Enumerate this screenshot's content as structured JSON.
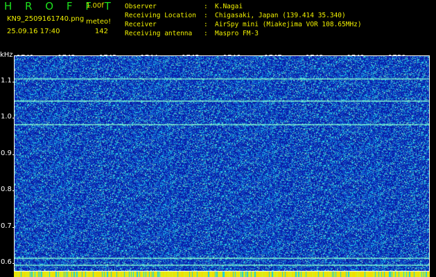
{
  "header": {
    "app_title": "H R O F F T",
    "version": "1.00f",
    "filename": "KN9_2509161740.png",
    "meteo_label": "meteo!",
    "datetime": "25.09.16 17:40",
    "count": "142"
  },
  "info": [
    {
      "key": "Observer",
      "value": "K.Nagai"
    },
    {
      "key": "Receiving Location",
      "value": "Chigasaki, Japan (139.414 35.340)"
    },
    {
      "key": "Receiver",
      "value": "AirSpy mini (Miakejima VOR 108.65MHz)"
    },
    {
      "key": "Receiving antenna",
      "value": "Maspro FM-3"
    }
  ],
  "info_separator": ":",
  "plot": {
    "y_unit": "kHz",
    "y_ticks": [
      {
        "value": 1.1,
        "label": "1.1"
      },
      {
        "value": 1.0,
        "label": "1.0"
      },
      {
        "value": 0.9,
        "label": "0.9"
      },
      {
        "value": 0.8,
        "label": "0.8"
      },
      {
        "value": 0.7,
        "label": "0.7"
      },
      {
        "value": 0.6,
        "label": "0.6"
      }
    ],
    "y_range": [
      0.578,
      1.172
    ],
    "x_ticks": [
      "1741",
      "1742",
      "1743",
      "1744",
      "1745",
      "1746",
      "1747",
      "1748",
      "1749",
      "1750"
    ],
    "x_range_minutes": [
      1740.55,
      1750.62
    ],
    "carrier_lines_khz": [
      1.112,
      1.05,
      0.985,
      0.618,
      0.598
    ],
    "colors": {
      "background": "#000000",
      "plot_base": "#0a1fa6",
      "noise_hot": "#19c8e6",
      "carrier": "#7df2d0",
      "text": "#ffffff",
      "header_text": "#f0f000",
      "title": "#1de01d"
    }
  }
}
